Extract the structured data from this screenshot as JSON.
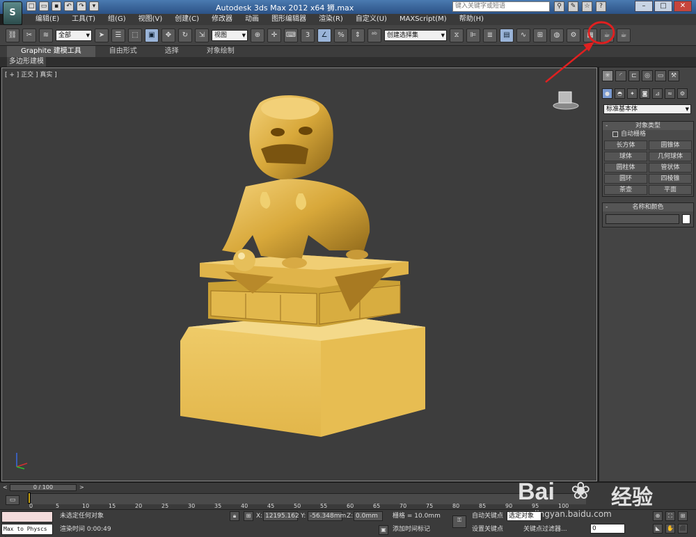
{
  "app": {
    "logo": "S",
    "title": "Autodesk 3ds Max  2012 x64      狮.max",
    "search_placeholder": "键入关键字或短语"
  },
  "menu": [
    "编辑(E)",
    "工具(T)",
    "组(G)",
    "视图(V)",
    "创建(C)",
    "修改器",
    "动画",
    "图形编辑器",
    "渲染(R)",
    "自定义(U)",
    "MAXScript(M)",
    "帮助(H)"
  ],
  "toolbar": {
    "filter_select": "全部",
    "ref_coord_select": "视图",
    "named_selection": "创建选择集"
  },
  "ribbon": {
    "tabs": [
      "Graphite 建模工具",
      "自由形式",
      "选择",
      "对象绘制"
    ],
    "sub_tab": "多边形建模"
  },
  "viewport": {
    "label": "[ + ] 正交 ] 真实 ]"
  },
  "command_panel": {
    "category_select": "标准基本体",
    "object_type_title": "对象类型",
    "autogrid_label": "自动栅格",
    "buttons": [
      "长方体",
      "圆锥体",
      "球体",
      "几何球体",
      "圆柱体",
      "管状体",
      "圆环",
      "四棱锥",
      "茶壶",
      "平面"
    ],
    "name_color_title": "名称和颜色"
  },
  "timeline": {
    "frame_counter": "0 / 100",
    "ticks": [
      "0",
      "5",
      "10",
      "15",
      "20",
      "25",
      "30",
      "35",
      "40",
      "45",
      "50",
      "55",
      "60",
      "65",
      "70",
      "75",
      "80",
      "85",
      "90",
      "95",
      "100"
    ]
  },
  "status": {
    "maxscript_text": "Max to Physcs (",
    "selection_status": "未选定任何对象",
    "render_time": "渲染时间  0:00:49",
    "x_label": "X:",
    "x_value": "12195.162",
    "y_label": "Y:",
    "y_value": "-56.348mm",
    "z_label": "Z:",
    "z_value": "0.0mm",
    "grid": "栅格 = 10.0mm",
    "add_time_tag": "添加时间标记",
    "auto_key": "自动关键点",
    "set_key": "设置关键点",
    "selected_object": "选定对象",
    "key_filters": "关键点过滤器...",
    "current_frame": "0"
  },
  "colors": {
    "highlight_circle": "#e02020",
    "statue_gold": "#d8a83a"
  },
  "watermark": {
    "brand": "Bai",
    "brand2": "经验",
    "url": "jingyan.baidu.com"
  }
}
